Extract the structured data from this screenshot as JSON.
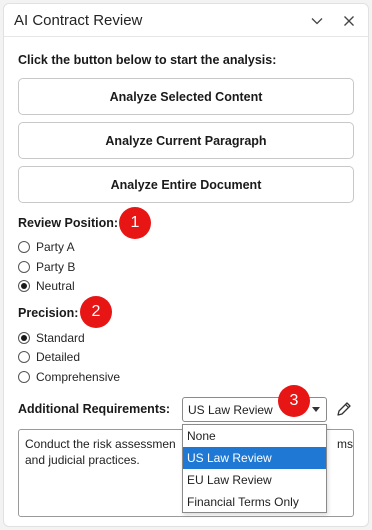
{
  "window": {
    "title": "AI Contract Review",
    "controls": [
      "chevron-down-icon",
      "close-icon"
    ]
  },
  "instruction": "Click the button below to start the analysis:",
  "buttons": [
    {
      "label": "Analyze Selected Content"
    },
    {
      "label": "Analyze Current Paragraph"
    },
    {
      "label": "Analyze Entire Document"
    }
  ],
  "review_position": {
    "label": "Review Position:",
    "options": [
      "Party A",
      "Party B",
      "Neutral"
    ],
    "selected": "Neutral"
  },
  "precision": {
    "label": "Precision:",
    "options": [
      "Standard",
      "Detailed",
      "Comprehensive"
    ],
    "selected": "Standard"
  },
  "additional": {
    "label": "Additional Requirements:",
    "select_value": "US Law Review",
    "dropdown_options": [
      "None",
      "US Law Review",
      "EU Law Review",
      "Financial Terms Only"
    ],
    "highlighted_option": "US Law Review",
    "textarea_line1_left": "Conduct the risk assessmen",
    "textarea_line1_right": "ms",
    "textarea_line2": "and judicial practices."
  },
  "badges": [
    "1",
    "2",
    "3"
  ],
  "colors": {
    "badge": "#e81515",
    "dropdown_highlight": "#1e78d4"
  }
}
